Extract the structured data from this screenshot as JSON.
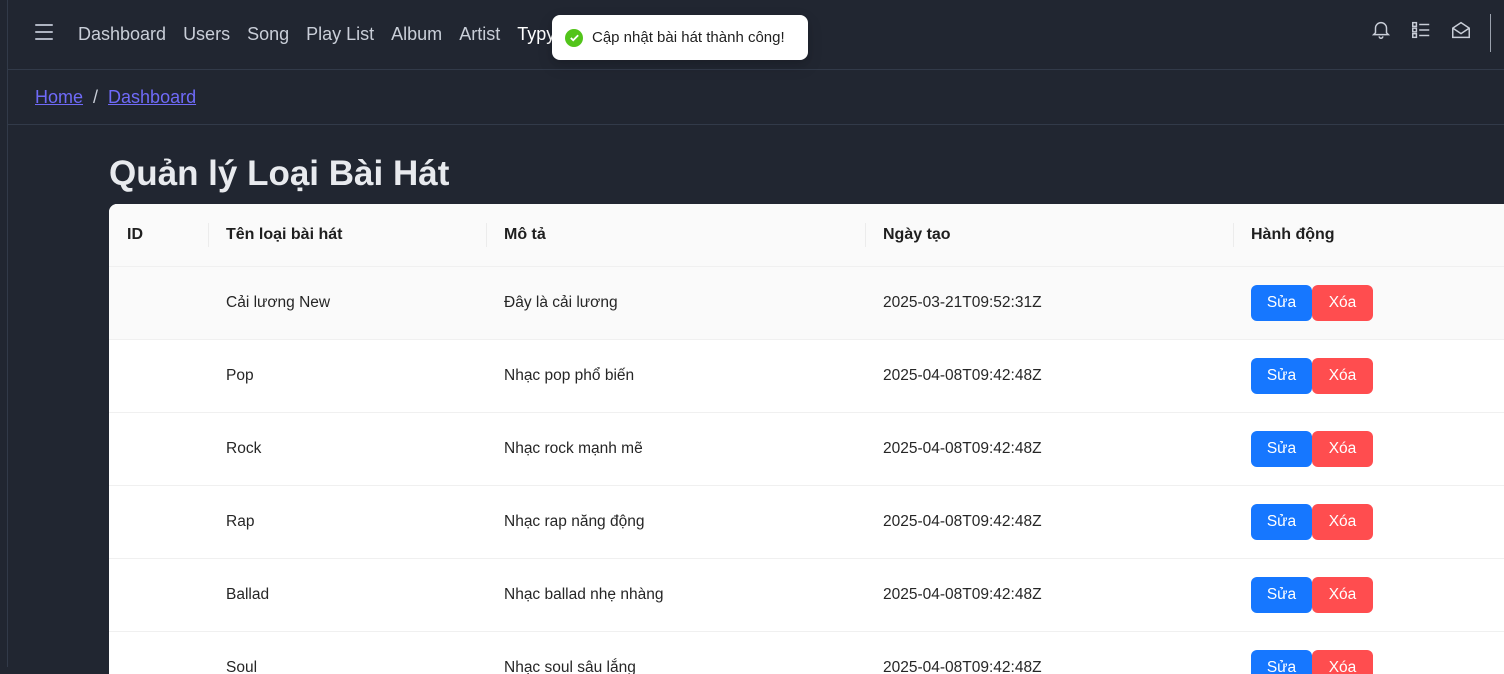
{
  "nav": {
    "items": [
      {
        "label": "Dashboard"
      },
      {
        "label": "Users"
      },
      {
        "label": "Song"
      },
      {
        "label": "Play List"
      },
      {
        "label": "Album"
      },
      {
        "label": "Artist"
      },
      {
        "label": "Typy"
      }
    ]
  },
  "header_icons": [
    "bell-icon",
    "list-icon",
    "mail-icon"
  ],
  "toast": {
    "message": "Cập nhật bài hát thành công!",
    "icon": "check-circle-icon",
    "color": "#52c41a"
  },
  "breadcrumb": {
    "home": "Home",
    "separator": "/",
    "current": "Dashboard"
  },
  "page": {
    "title": "Quản lý Loại Bài Hát"
  },
  "table": {
    "columns": [
      "ID",
      "Tên loại bài hát",
      "Mô tả",
      "Ngày tạo",
      "Hành động"
    ],
    "rows": [
      {
        "id": "",
        "name": "Cải lương New",
        "desc": "Đây là cải lương",
        "created": "2025-03-21T09:52:31Z"
      },
      {
        "id": "",
        "name": "Pop",
        "desc": "Nhạc pop phổ biến",
        "created": "2025-04-08T09:42:48Z"
      },
      {
        "id": "",
        "name": "Rock",
        "desc": "Nhạc rock mạnh mẽ",
        "created": "2025-04-08T09:42:48Z"
      },
      {
        "id": "",
        "name": "Rap",
        "desc": "Nhạc rap năng động",
        "created": "2025-04-08T09:42:48Z"
      },
      {
        "id": "",
        "name": "Ballad",
        "desc": "Nhạc ballad nhẹ nhàng",
        "created": "2025-04-08T09:42:48Z"
      },
      {
        "id": "",
        "name": "Soul",
        "desc": "Nhạc soul sâu lắng",
        "created": "2025-04-08T09:42:48Z"
      }
    ],
    "edit_label": "Sửa",
    "delete_label": "Xóa"
  },
  "colors": {
    "background": "#212631",
    "edit": "#1677ff",
    "delete": "#ff4d4f",
    "link": "#6f6af8"
  }
}
